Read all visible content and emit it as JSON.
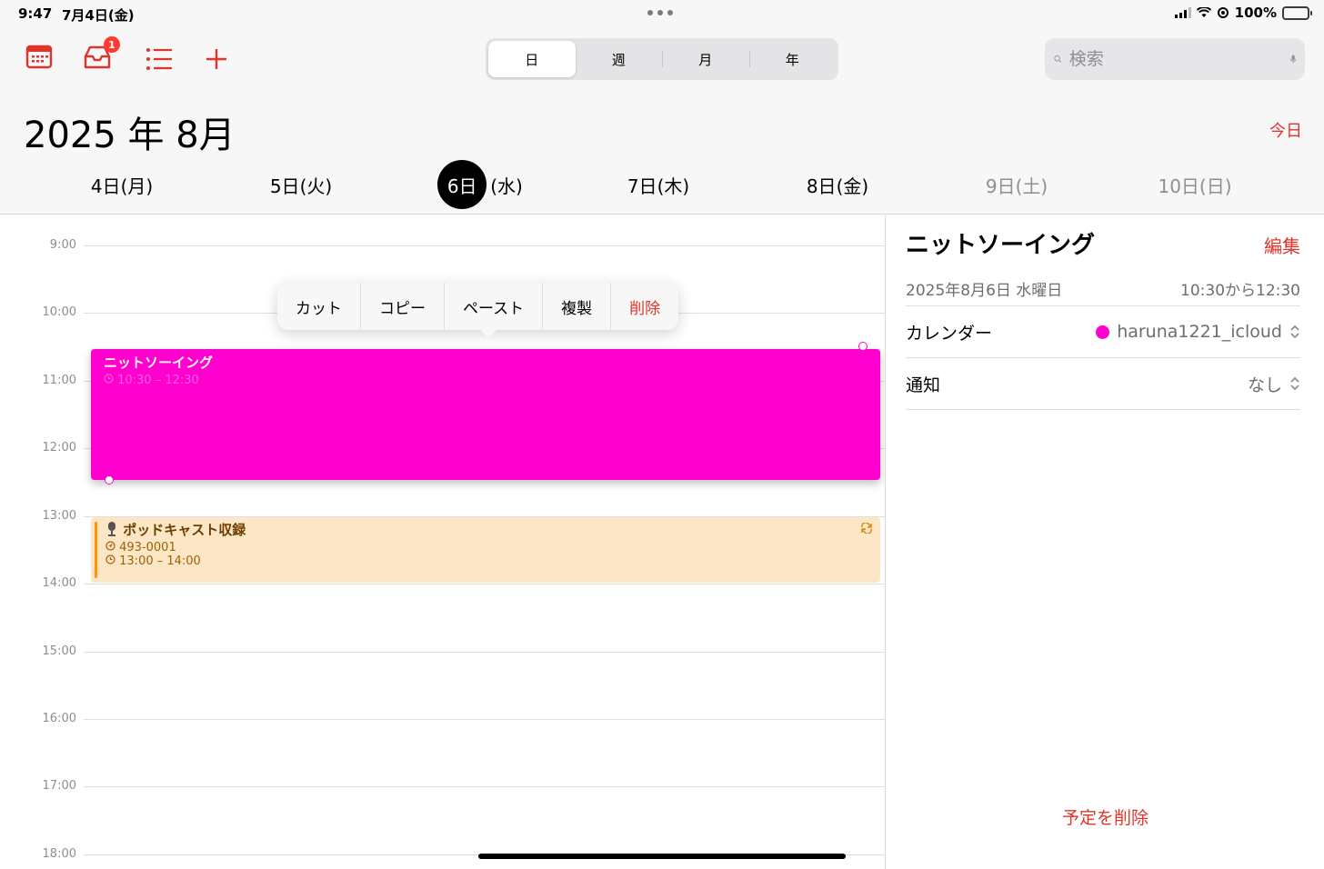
{
  "status": {
    "time": "9:47",
    "date": "7月4日(金)",
    "battery": "100%"
  },
  "toolbar": {
    "inbox_badge": "1"
  },
  "view_tabs": [
    {
      "label": "日",
      "selected": true
    },
    {
      "label": "週",
      "selected": false
    },
    {
      "label": "月",
      "selected": false
    },
    {
      "label": "年",
      "selected": false
    }
  ],
  "search": {
    "placeholder": "検索"
  },
  "header": {
    "month_title": "2025 年 8月",
    "today_label": "今日"
  },
  "week": [
    {
      "num": "4日",
      "dow": "(月)"
    },
    {
      "num": "5日",
      "dow": "(火)"
    },
    {
      "num": "6日",
      "dow": "(水)",
      "selected": true
    },
    {
      "num": "7日",
      "dow": "(木)"
    },
    {
      "num": "8日",
      "dow": "(金)"
    },
    {
      "num": "9日",
      "dow": "(土)"
    },
    {
      "num": "10日",
      "dow": "(日)"
    }
  ],
  "hours": [
    "9:00",
    "10:00",
    "11:00",
    "12:00",
    "13:00",
    "14:00",
    "15:00",
    "16:00",
    "17:00",
    "18:00"
  ],
  "context_menu": [
    "カット",
    "コピー",
    "ペースト",
    "複製",
    "削除"
  ],
  "events": {
    "knit": {
      "title": "ニットソーイング",
      "time": "10:30 – 12:30",
      "color": "#ff00cf"
    },
    "podcast": {
      "title": "ポッドキャスト収録",
      "location": "493-0001",
      "time": "13:00 – 14:00",
      "color": "#ff9500"
    }
  },
  "detail": {
    "title": "ニットソーイング",
    "edit_label": "編集",
    "date": "2025年8月6日 水曜日",
    "time_range": "10:30から12:30",
    "calendar_label": "カレンダー",
    "calendar_value": "haruna1221_icloud",
    "alert_label": "通知",
    "alert_value": "なし",
    "delete_label": "予定を削除"
  },
  "colors": {
    "accent": "#e0342b",
    "event_magenta": "#ff00cf",
    "event_orange": "#ff9500"
  }
}
